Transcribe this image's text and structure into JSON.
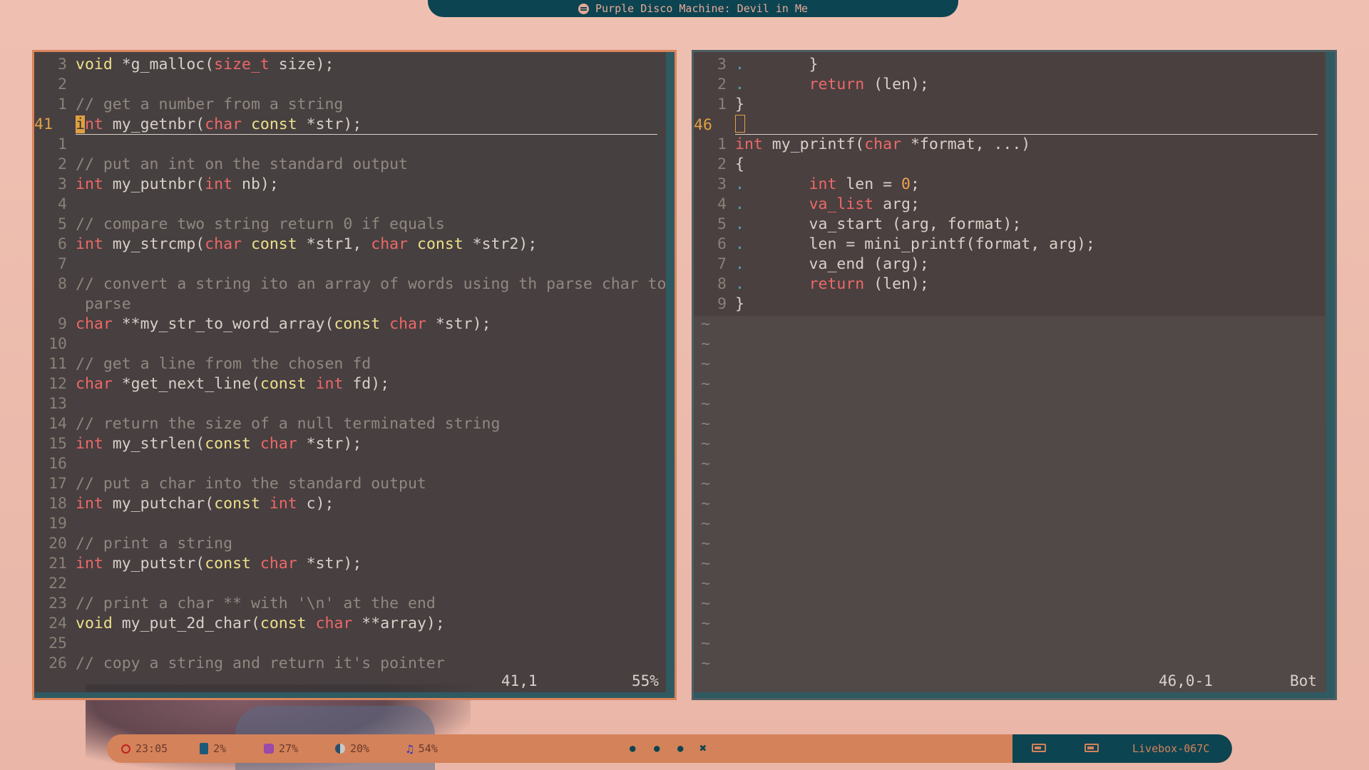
{
  "topbar": {
    "now_playing": "Purple Disco Machine: Devil in Me",
    "icon": "spotify-icon"
  },
  "left_pane": {
    "lines": [
      {
        "num": "3",
        "tokens": [
          [
            "kw",
            "void"
          ],
          [
            "plain",
            " *g_malloc("
          ],
          [
            "type",
            "size_t"
          ],
          [
            "plain",
            " size);"
          ]
        ]
      },
      {
        "num": "2",
        "tokens": []
      },
      {
        "num": "1",
        "tokens": [
          [
            "com",
            "// get a number from a string"
          ]
        ]
      },
      {
        "num": "41",
        "current": true,
        "tokens": [
          [
            "cursor",
            "i"
          ],
          [
            "type",
            "nt"
          ],
          [
            "plain",
            " my_getnbr("
          ],
          [
            "type",
            "char"
          ],
          [
            "plain",
            " "
          ],
          [
            "kw",
            "const"
          ],
          [
            "plain",
            " *str);"
          ]
        ]
      },
      {
        "num": "1",
        "tokens": []
      },
      {
        "num": "2",
        "tokens": [
          [
            "com",
            "// put an int on the standard output"
          ]
        ]
      },
      {
        "num": "3",
        "tokens": [
          [
            "type",
            "int"
          ],
          [
            "plain",
            " my_putnbr("
          ],
          [
            "type",
            "int"
          ],
          [
            "plain",
            " nb);"
          ]
        ]
      },
      {
        "num": "4",
        "tokens": []
      },
      {
        "num": "5",
        "tokens": [
          [
            "com",
            "// compare two string return 0 if equals"
          ]
        ]
      },
      {
        "num": "6",
        "tokens": [
          [
            "type",
            "int"
          ],
          [
            "plain",
            " my_strcmp("
          ],
          [
            "type",
            "char"
          ],
          [
            "plain",
            " "
          ],
          [
            "kw",
            "const"
          ],
          [
            "plain",
            " *str1, "
          ],
          [
            "type",
            "char"
          ],
          [
            "plain",
            " "
          ],
          [
            "kw",
            "const"
          ],
          [
            "plain",
            " *str2);"
          ]
        ]
      },
      {
        "num": "7",
        "tokens": []
      },
      {
        "num": "8",
        "tokens": [
          [
            "com",
            "// convert a string ito an array of words using th parse char to"
          ]
        ]
      },
      {
        "num": "",
        "tokens": [
          [
            "com",
            " parse"
          ]
        ]
      },
      {
        "num": "9",
        "tokens": [
          [
            "type",
            "char"
          ],
          [
            "plain",
            " **my_str_to_word_array("
          ],
          [
            "kw",
            "const"
          ],
          [
            "plain",
            " "
          ],
          [
            "type",
            "char"
          ],
          [
            "plain",
            " *str);"
          ]
        ]
      },
      {
        "num": "10",
        "tokens": []
      },
      {
        "num": "11",
        "tokens": [
          [
            "com",
            "// get a line from the chosen fd"
          ]
        ]
      },
      {
        "num": "12",
        "tokens": [
          [
            "type",
            "char"
          ],
          [
            "plain",
            " *get_next_line("
          ],
          [
            "kw",
            "const"
          ],
          [
            "plain",
            " "
          ],
          [
            "type",
            "int"
          ],
          [
            "plain",
            " fd);"
          ]
        ]
      },
      {
        "num": "13",
        "tokens": []
      },
      {
        "num": "14",
        "tokens": [
          [
            "com",
            "// return the size of a null terminated string"
          ]
        ]
      },
      {
        "num": "15",
        "tokens": [
          [
            "type",
            "int"
          ],
          [
            "plain",
            " my_strlen("
          ],
          [
            "kw",
            "const"
          ],
          [
            "plain",
            " "
          ],
          [
            "type",
            "char"
          ],
          [
            "plain",
            " *str);"
          ]
        ]
      },
      {
        "num": "16",
        "tokens": []
      },
      {
        "num": "17",
        "tokens": [
          [
            "com",
            "// put a char into the standard output"
          ]
        ]
      },
      {
        "num": "18",
        "tokens": [
          [
            "type",
            "int"
          ],
          [
            "plain",
            " my_putchar("
          ],
          [
            "kw",
            "const"
          ],
          [
            "plain",
            " "
          ],
          [
            "type",
            "int"
          ],
          [
            "plain",
            " c);"
          ]
        ]
      },
      {
        "num": "19",
        "tokens": []
      },
      {
        "num": "20",
        "tokens": [
          [
            "com",
            "// print a string"
          ]
        ]
      },
      {
        "num": "21",
        "tokens": [
          [
            "type",
            "int"
          ],
          [
            "plain",
            " my_putstr("
          ],
          [
            "kw",
            "const"
          ],
          [
            "plain",
            " "
          ],
          [
            "type",
            "char"
          ],
          [
            "plain",
            " *str);"
          ]
        ]
      },
      {
        "num": "22",
        "tokens": []
      },
      {
        "num": "23",
        "tokens": [
          [
            "com",
            "// print a char ** with '\\n' at the end"
          ]
        ]
      },
      {
        "num": "24",
        "tokens": [
          [
            "kw",
            "void"
          ],
          [
            "plain",
            " my_put_2d_char("
          ],
          [
            "kw",
            "const"
          ],
          [
            "plain",
            " "
          ],
          [
            "type",
            "char"
          ],
          [
            "plain",
            " **array);"
          ]
        ]
      },
      {
        "num": "25",
        "tokens": []
      },
      {
        "num": "26",
        "tokens": [
          [
            "com",
            "// copy a string and return it's pointer"
          ]
        ]
      }
    ],
    "status_pos": "41,1",
    "status_pct": "55%"
  },
  "right_pane": {
    "lines": [
      {
        "num": "3",
        "tokens": [
          [
            "dot",
            "."
          ],
          [
            "plain",
            "       }"
          ]
        ]
      },
      {
        "num": "2",
        "tokens": [
          [
            "dot",
            "."
          ],
          [
            "plain",
            "       "
          ],
          [
            "type",
            "return"
          ],
          [
            "plain",
            " (len);"
          ]
        ]
      },
      {
        "num": "1",
        "tokens": [
          [
            "plain",
            "}"
          ]
        ]
      },
      {
        "num": "46",
        "current": true,
        "tokens": [
          [
            "cursorbox",
            ""
          ]
        ]
      },
      {
        "num": "1",
        "tokens": [
          [
            "type",
            "int"
          ],
          [
            "plain",
            " my_printf("
          ],
          [
            "type",
            "char"
          ],
          [
            "plain",
            " *format, ...)"
          ]
        ]
      },
      {
        "num": "2",
        "tokens": [
          [
            "plain",
            "{"
          ]
        ]
      },
      {
        "num": "3",
        "tokens": [
          [
            "dot",
            "."
          ],
          [
            "plain",
            "       "
          ],
          [
            "type",
            "int"
          ],
          [
            "plain",
            " len = "
          ],
          [
            "num",
            "0"
          ],
          [
            "plain",
            ";"
          ]
        ]
      },
      {
        "num": "4",
        "tokens": [
          [
            "dot",
            "."
          ],
          [
            "plain",
            "       "
          ],
          [
            "type",
            "va_list"
          ],
          [
            "plain",
            " arg;"
          ]
        ]
      },
      {
        "num": "5",
        "tokens": [
          [
            "dot",
            "."
          ],
          [
            "plain",
            "       va_start (arg, format);"
          ]
        ]
      },
      {
        "num": "6",
        "tokens": [
          [
            "dot",
            "."
          ],
          [
            "plain",
            "       len = mini_printf(format, arg);"
          ]
        ]
      },
      {
        "num": "7",
        "tokens": [
          [
            "dot",
            "."
          ],
          [
            "plain",
            "       va_end (arg);"
          ]
        ]
      },
      {
        "num": "8",
        "tokens": [
          [
            "dot",
            "."
          ],
          [
            "plain",
            "       "
          ],
          [
            "type",
            "return"
          ],
          [
            "plain",
            " (len);"
          ]
        ]
      },
      {
        "num": "9",
        "tokens": [
          [
            "plain",
            "}"
          ]
        ]
      }
    ],
    "tilde_count": 18,
    "tilde_char": "~",
    "status_pos": "46,0-1",
    "status_pct": "Bot"
  },
  "bottombar": {
    "clock": "23:05",
    "cpu": "2%",
    "memory": "27%",
    "disk": "20%",
    "volume": "54%",
    "workspaces": [
      "●",
      "●",
      "●",
      "✖"
    ],
    "network": "Livebox-067C"
  }
}
